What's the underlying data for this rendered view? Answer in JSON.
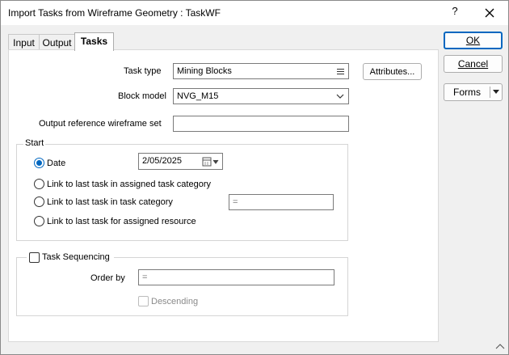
{
  "window": {
    "title": "Import Tasks from Wireframe Geometry : TaskWF",
    "help_label": "?",
    "close_label": "✕"
  },
  "tabs": [
    {
      "label": "Input"
    },
    {
      "label": "Output"
    },
    {
      "label": "Tasks"
    }
  ],
  "active_tab": "Tasks",
  "form": {
    "task_type_label": "Task type",
    "task_type_value": "Mining Blocks",
    "attributes_button": "Attributes...",
    "block_model_label": "Block model",
    "block_model_value": "NVG_M15",
    "output_ref_label": "Output reference wireframe set",
    "output_ref_value": ""
  },
  "start": {
    "group_label": "Start",
    "options": [
      {
        "label": "Date",
        "checked": true
      },
      {
        "label": "Link to last task in assigned task category",
        "checked": false
      },
      {
        "label": "Link to last task in task category",
        "checked": false
      },
      {
        "label": "Link to last task for assigned resource",
        "checked": false
      }
    ],
    "date_value": "2/05/2025",
    "task_category_value": "="
  },
  "sequencing": {
    "checkbox_label": "Task Sequencing",
    "checked": false,
    "order_by_label": "Order by",
    "order_by_value": "=",
    "descending_label": "Descending",
    "descending_checked": false
  },
  "buttons": {
    "ok": "OK",
    "cancel": "Cancel",
    "forms": "Forms"
  },
  "colors": {
    "accent": "#0067c0",
    "dialog_bg": "#f0f0f0",
    "panel_bg": "#ffffff"
  }
}
